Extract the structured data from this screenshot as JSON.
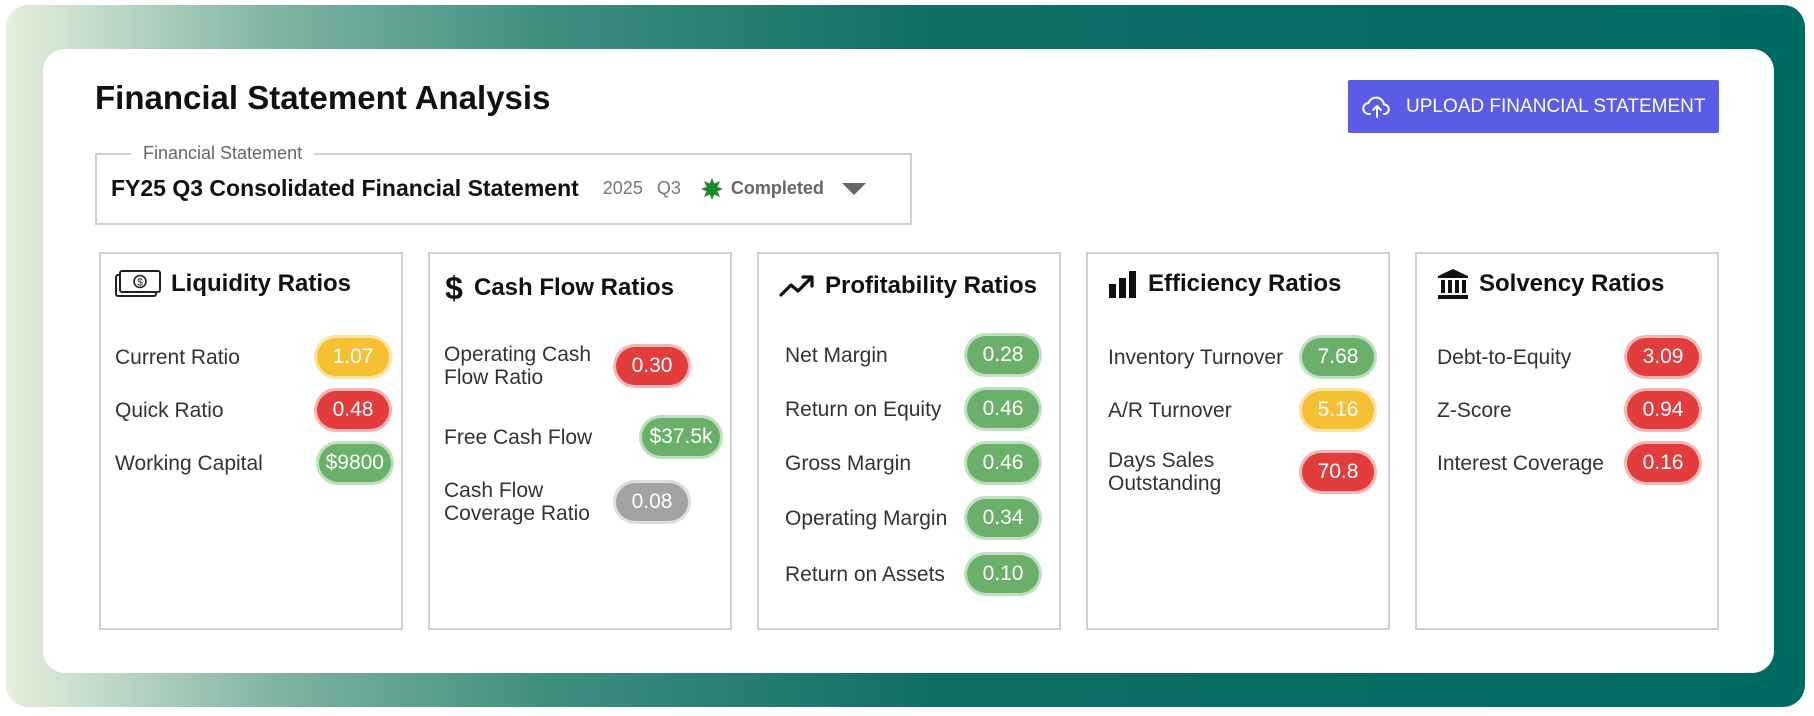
{
  "page": {
    "title": "Financial Statement Analysis",
    "upload_button": "UPLOAD FINANCIAL STATEMENT"
  },
  "statement_selector": {
    "legend": "Financial Statement",
    "name": "FY25 Q3 Consolidated Financial Statement",
    "year": "2025",
    "quarter": "Q3",
    "status": "Completed"
  },
  "colors": {
    "accent": "#5b5ce6",
    "good": "#6ab06b",
    "bad": "#e23c3c",
    "warning": "#f5c033",
    "neutral": "#a3a3a3",
    "status_icon": "#1f8a2c"
  },
  "panels": [
    {
      "title": "Liquidity Ratios",
      "icon": "money-bill-icon",
      "metrics": [
        {
          "label": "Current Ratio",
          "value": "1.07",
          "status": "warning"
        },
        {
          "label": "Quick Ratio",
          "value": "0.48",
          "status": "bad"
        },
        {
          "label": "Working Capital",
          "value": "$9800",
          "status": "good"
        }
      ]
    },
    {
      "title": "Cash Flow Ratios",
      "icon": "dollar-sign-icon",
      "metrics": [
        {
          "label": "Operating Cash Flow Ratio",
          "value": "0.30",
          "status": "bad"
        },
        {
          "label": "Free Cash Flow",
          "value": "$37.5k",
          "status": "good"
        },
        {
          "label": "Cash Flow Coverage Ratio",
          "value": "0.08",
          "status": "neutral"
        }
      ]
    },
    {
      "title": "Profitability Ratios",
      "icon": "trending-up-icon",
      "metrics": [
        {
          "label": "Net Margin",
          "value": "0.28",
          "status": "good"
        },
        {
          "label": "Return on Equity",
          "value": "0.46",
          "status": "good"
        },
        {
          "label": "Gross Margin",
          "value": "0.46",
          "status": "good"
        },
        {
          "label": "Operating Margin",
          "value": "0.34",
          "status": "good"
        },
        {
          "label": "Return on Assets",
          "value": "0.10",
          "status": "good"
        }
      ]
    },
    {
      "title": "Efficiency Ratios",
      "icon": "bar-chart-icon",
      "metrics": [
        {
          "label": "Inventory Turnover",
          "value": "7.68",
          "status": "good"
        },
        {
          "label": "A/R Turnover",
          "value": "5.16",
          "status": "warning"
        },
        {
          "label": "Days Sales Outstanding",
          "value": "70.8",
          "status": "bad"
        }
      ]
    },
    {
      "title": "Solvency Ratios",
      "icon": "bank-icon",
      "metrics": [
        {
          "label": "Debt-to-Equity",
          "value": "3.09",
          "status": "bad"
        },
        {
          "label": "Z-Score",
          "value": "0.94",
          "status": "bad"
        },
        {
          "label": "Interest Coverage",
          "value": "0.16",
          "status": "bad"
        }
      ]
    }
  ]
}
